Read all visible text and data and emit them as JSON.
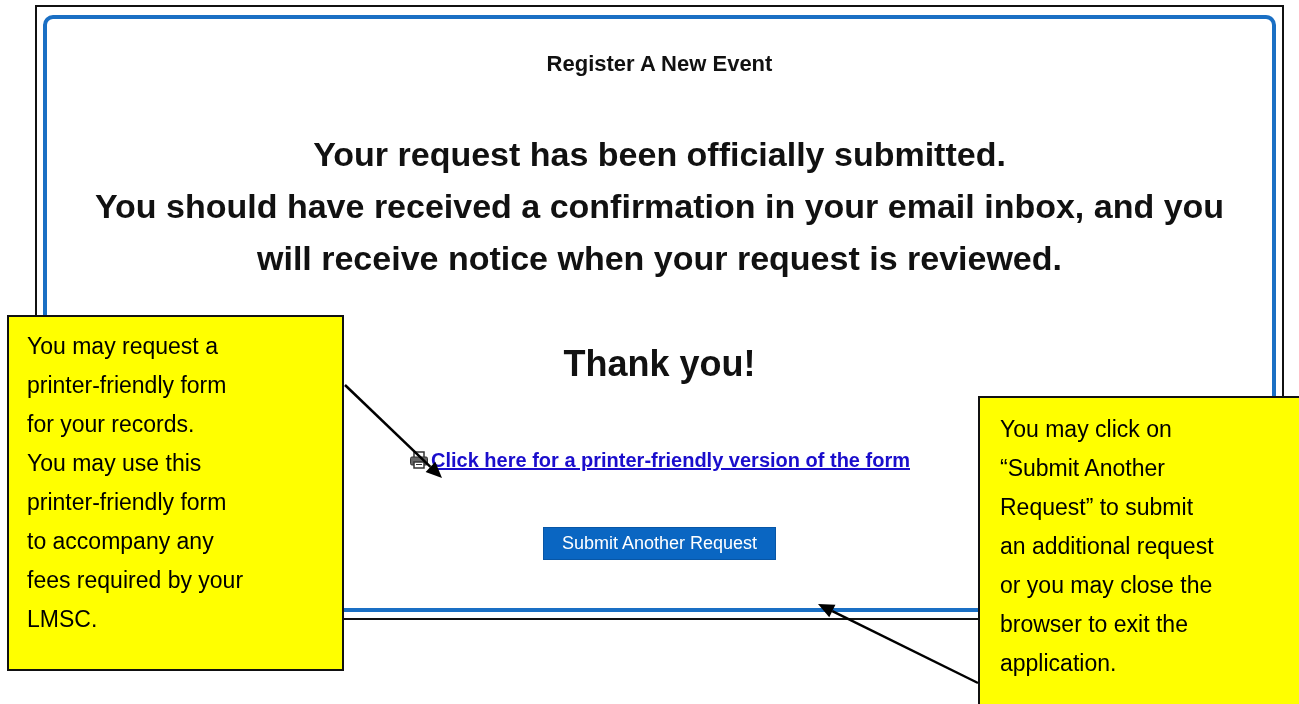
{
  "page": {
    "heading": "Register A New Event",
    "message_lines": [
      "Your request has been officially submitted.",
      "You should have received a confirmation in your email inbox, and you will receive notice when your request is reviewed."
    ],
    "thanks": "Thank you!",
    "print_link": "Click here for a printer-friendly version of the form",
    "button": "Submit Another Request"
  },
  "callouts": [
    {
      "kind": "left",
      "lines": [
        "You may request a",
        "printer-friendly form",
        "for your records.",
        "You may use this",
        "printer-friendly form",
        "to accompany any",
        "fees required by your",
        "LMSC."
      ]
    },
    {
      "kind": "right",
      "lines": [
        "You may click on",
        "“Submit Another",
        "Request” to submit",
        "an additional request",
        "or you may close the",
        "browser to exit the",
        "application."
      ]
    }
  ]
}
